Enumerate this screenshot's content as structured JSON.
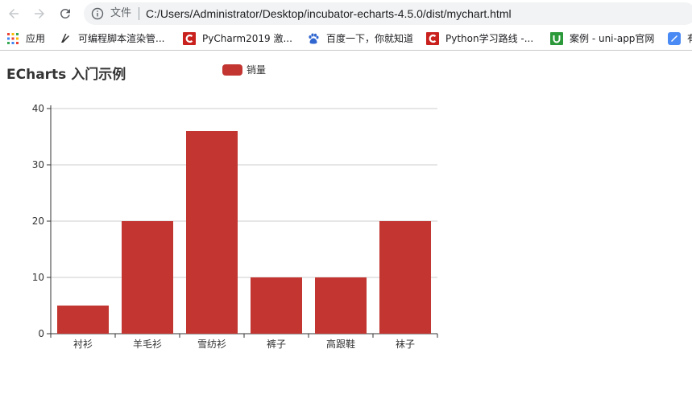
{
  "browser": {
    "scheme_label": "文件",
    "url": "C:/Users/Administrator/Desktop/incubator-echarts-4.5.0/dist/mychart.html"
  },
  "bookmarks": [
    {
      "label": "应用",
      "icon": "apps-grid-icon"
    },
    {
      "label": "可编程脚本渲染管...",
      "icon": "script-icon"
    },
    {
      "label": "PyCharm2019 激...",
      "icon": "csdn-icon"
    },
    {
      "label": "百度一下，你就知道",
      "icon": "baidu-paw-icon"
    },
    {
      "label": "Python学习路线 -...",
      "icon": "csdn-icon"
    },
    {
      "label": "案例 - uni-app官网",
      "icon": "uniapp-icon"
    },
    {
      "label": "有",
      "icon": "blue-doc-icon"
    }
  ],
  "chart": {
    "title": "ECharts 入门示例",
    "legend_label": "销量",
    "bar_color": "#c23531"
  },
  "chart_data": {
    "type": "bar",
    "title": "ECharts 入门示例",
    "categories": [
      "衬衫",
      "羊毛衫",
      "雪纺衫",
      "裤子",
      "高跟鞋",
      "袜子"
    ],
    "series": [
      {
        "name": "销量",
        "values": [
          5,
          20,
          36,
          10,
          10,
          20
        ]
      }
    ],
    "ylim": [
      0,
      40
    ],
    "yticks": [
      0,
      10,
      20,
      30,
      40
    ],
    "grid": true,
    "legend_position": "top"
  }
}
